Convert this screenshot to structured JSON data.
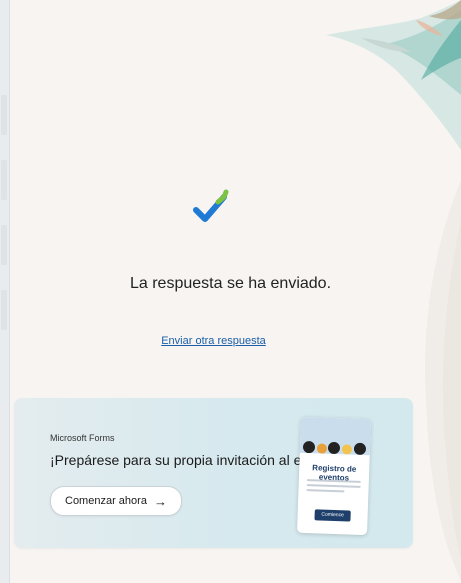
{
  "confirmation": {
    "message": "La respuesta se ha enviado.",
    "send_another": "Enviar otra respuesta"
  },
  "promo": {
    "brand": "Microsoft Forms",
    "title": "¡Prepárese para su propia invitación al evento!",
    "button_label": "Comenzar ahora",
    "card_title": "Registro de eventos",
    "card_button": "Comience ahora"
  },
  "colors": {
    "background": "#f7f4f1",
    "link": "#1a5fa8",
    "promo_bg": "#d6e9ee",
    "check_blue": "#1f7ad6",
    "check_green": "#7cc243"
  },
  "icons": {
    "check": "check-icon",
    "arrow": "arrow-right-icon"
  }
}
